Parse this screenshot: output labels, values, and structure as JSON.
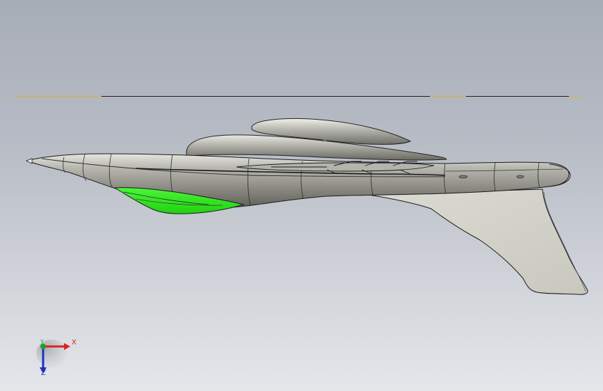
{
  "scene": {
    "background_top": "#a7adb8",
    "background_bottom": "#e4e6ea"
  },
  "model": {
    "body_color": "#9a9a92",
    "fin_color": "#d2d1c8",
    "highlight_face_color": "#33ee22"
  },
  "triad": {
    "x_label": "X",
    "y_label": "Y",
    "z_label": "Z",
    "x_color": "#e02020",
    "y_color": "#20a020",
    "z_color": "#2030c0"
  }
}
